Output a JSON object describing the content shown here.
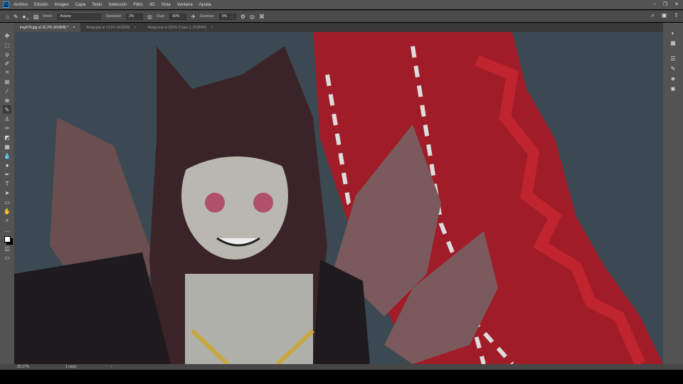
{
  "menu": [
    "Archivo",
    "Edición",
    "Imagen",
    "Capa",
    "Texto",
    "Selección",
    "Filtro",
    "3D",
    "Vista",
    "Ventana",
    "Ayuda"
  ],
  "options": {
    "mode_label": "Modo:",
    "mode_value": "Aclarar",
    "opacity_label": "Opacidad:",
    "opacity_value": "2%",
    "flow_label": "Flujo:",
    "flow_value": "90%",
    "smooth_label": "Suavizar:",
    "smooth_value": "0%",
    "brush_size": "30"
  },
  "tabs": [
    {
      "label": "img479.jpg al 32,2% (RGB/8) *"
    },
    {
      "label": "Akagi.jpg al 12,5% (RGB/8)"
    },
    {
      "label": "Akagi.png al 283% (Capa 1, RGB/8#)"
    }
  ],
  "status": {
    "zoom": "32.17%",
    "layers": "1 capa"
  },
  "colors": {
    "bg": "#3b4a52",
    "flame": "#b0202a",
    "fur": "#6a4a4a"
  }
}
